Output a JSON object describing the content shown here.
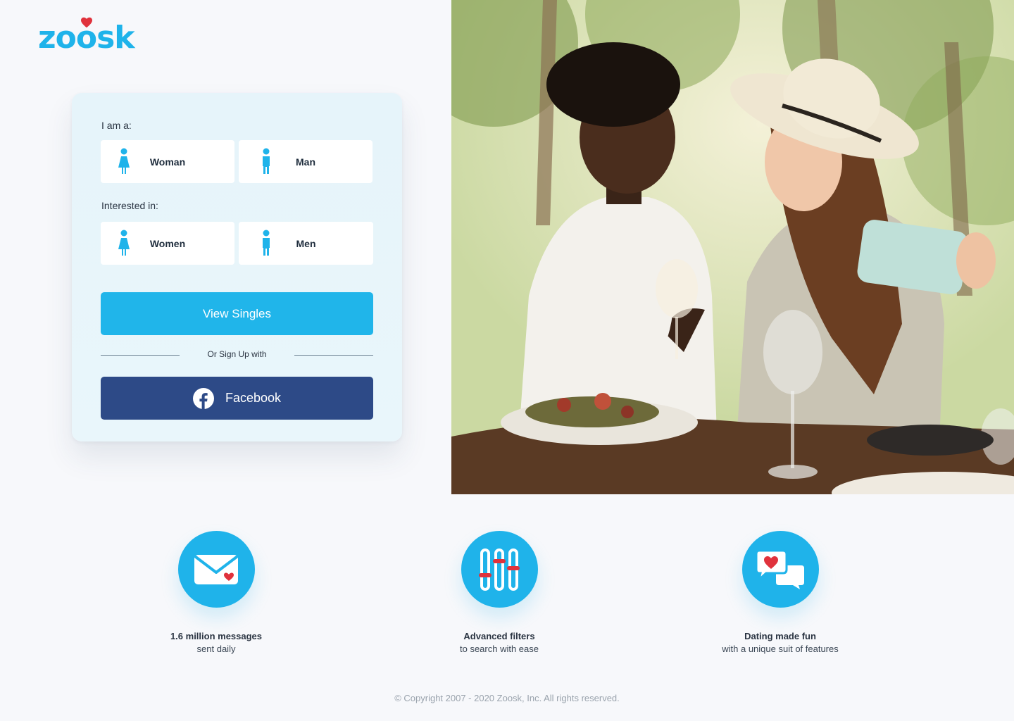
{
  "brand": {
    "name_prefix": "zo",
    "name_o": "o",
    "name_suffix": "sk",
    "color": "#1fb3ea",
    "heart_color": "#e0323c"
  },
  "form": {
    "i_am_label": "I am a:",
    "i_am_options": [
      {
        "label": "Woman",
        "icon": "woman-icon"
      },
      {
        "label": "Man",
        "icon": "man-icon"
      }
    ],
    "interested_label": "Interested in:",
    "interested_options": [
      {
        "label": "Women",
        "icon": "woman-icon"
      },
      {
        "label": "Men",
        "icon": "man-icon"
      }
    ],
    "primary_button": "View Singles",
    "divider_text": "Or Sign Up with",
    "facebook_button": "Facebook"
  },
  "colors": {
    "primary": "#20b5ea",
    "facebook": "#2d4a87",
    "background": "#f7f8fb"
  },
  "features": [
    {
      "icon": "envelope-heart-icon",
      "title": "1.6 million messages",
      "subtitle": "sent daily"
    },
    {
      "icon": "sliders-icon",
      "title": "Advanced filters",
      "subtitle": "to search with ease"
    },
    {
      "icon": "chat-heart-icon",
      "title": "Dating made fun",
      "subtitle": "with a unique suit of features"
    }
  ],
  "footer": {
    "copyright": "© Copyright 2007 - 2020 Zoosk, Inc. All rights reserved."
  }
}
